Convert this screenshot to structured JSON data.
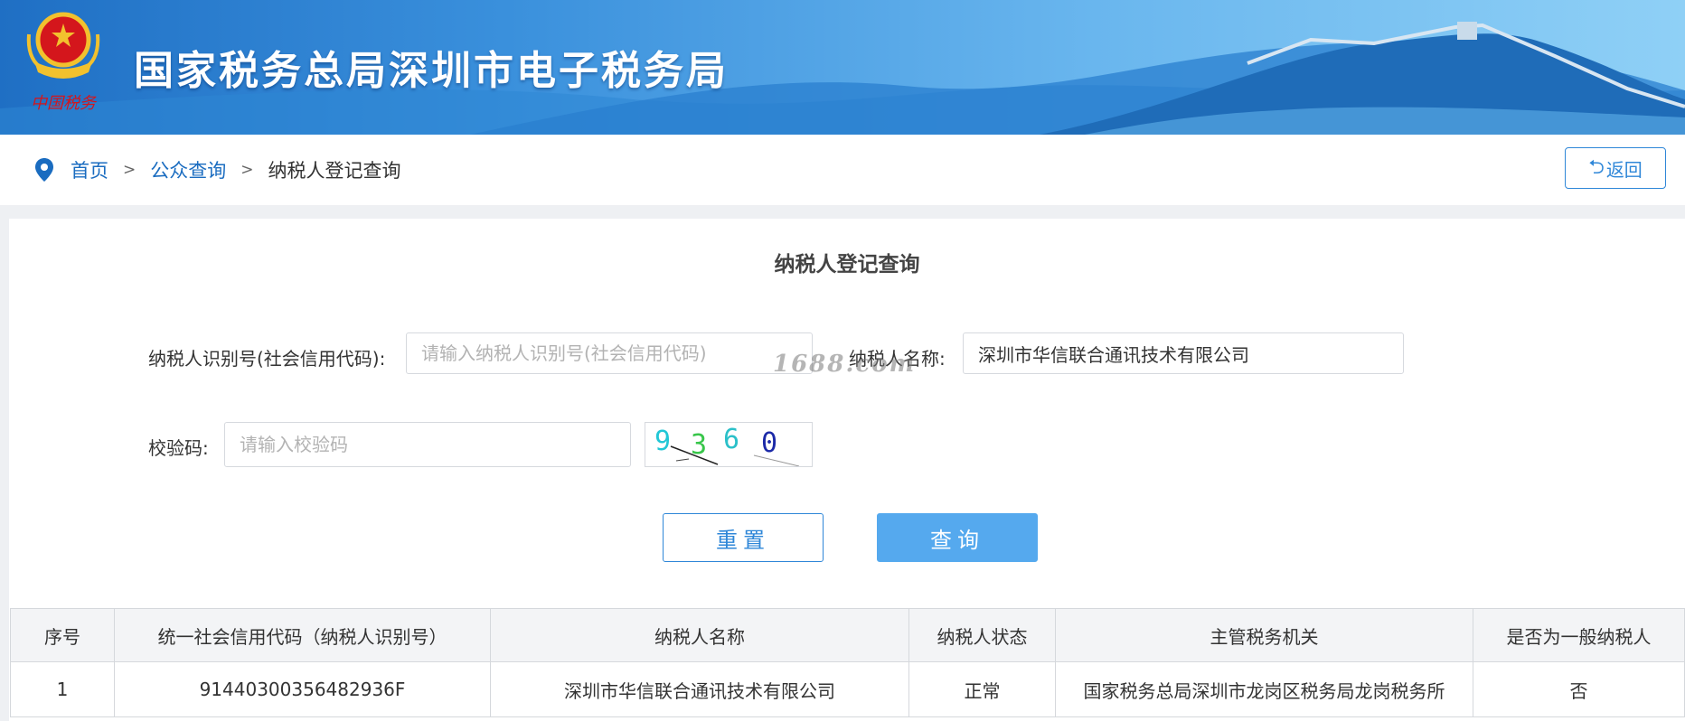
{
  "header": {
    "site_title": "国家税务总局深圳市电子税务局",
    "emblem_caption": "中国税务",
    "colors": {
      "banner_start": "#1f6fc4",
      "banner_end": "#8fd0f6",
      "accent": "#2f87d8"
    }
  },
  "breadcrumb": {
    "icon": "location-pin-icon",
    "items": [
      {
        "label": "首页",
        "link": true
      },
      {
        "label": "公众查询",
        "link": true
      },
      {
        "label": "纳税人登记查询",
        "link": false
      }
    ],
    "separator": ">"
  },
  "back_button": {
    "icon": "undo-arrow-icon",
    "icon_glyph": "⮌",
    "label": "返回"
  },
  "form": {
    "title": "纳税人登记查询",
    "taxpayer_id": {
      "label": "纳税人识别号(社会信用代码):",
      "placeholder": "请输入纳税人识别号(社会信用代码)",
      "value": ""
    },
    "taxpayer_name": {
      "label": "纳税人名称:",
      "placeholder": "",
      "value": "深圳市华信联合通讯技术有限公司"
    },
    "captcha": {
      "label": "校验码:",
      "placeholder": "请输入校验码",
      "value": "",
      "image_text": "9360"
    },
    "reset_label": "重置",
    "query_label": "查询"
  },
  "watermark": "1688.com",
  "results": {
    "columns": [
      "序号",
      "统一社会信用代码（纳税人识别号）",
      "纳税人名称",
      "纳税人状态",
      "主管税务机关",
      "是否为一般纳税人"
    ],
    "rows": [
      [
        "1",
        "91440300356482936F",
        "深圳市华信联合通讯技术有限公司",
        "正常",
        "国家税务总局深圳市龙岗区税务局龙岗税务所",
        "否"
      ]
    ]
  }
}
